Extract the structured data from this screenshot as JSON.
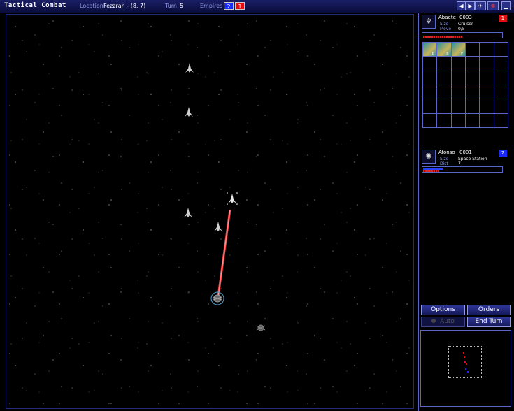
{
  "topbar": {
    "title": "Tactical Combat",
    "location_label": "Location",
    "location_value": "Fezzran - (8, 7)",
    "turn_label": "Turn",
    "turn_value": "5",
    "empires_label": "Empires",
    "empire_badges": [
      {
        "text": "2",
        "color": "#1a2aff"
      },
      {
        "text": "1",
        "color": "#e01010"
      }
    ],
    "buttons": [
      {
        "name": "arrow-left-icon",
        "glyph": "◀"
      },
      {
        "name": "arrow-right-icon",
        "glyph": "▶"
      },
      {
        "name": "bird-icon",
        "glyph": "✈"
      },
      {
        "name": "close-circle-icon",
        "glyph": "⊗"
      },
      {
        "name": "minimize-icon",
        "glyph": "▁"
      }
    ]
  },
  "colors": {
    "frame": "#5a66c8",
    "laser": "#ff4444",
    "empire_red": "#e01010",
    "empire_blue": "#1a2aff"
  },
  "map": {
    "ships": [
      {
        "name": "ship",
        "icon": "cruiser-icon"
      },
      {
        "name": "ship",
        "icon": "cruiser-icon"
      },
      {
        "name": "ship-selected",
        "icon": "cruiser-icon"
      },
      {
        "name": "ship",
        "icon": "cruiser-icon"
      },
      {
        "name": "ship",
        "icon": "cruiser-icon"
      },
      {
        "name": "space-station",
        "icon": "station-icon"
      },
      {
        "name": "space-station-2",
        "icon": "station-icon"
      }
    ]
  },
  "selected_ship": {
    "name": "Abaete",
    "number": "0003",
    "size_label": "Size",
    "size_value": "Cruiser",
    "move_label": "Move",
    "move_value": "0/5",
    "badge": "1",
    "badge_color": "#e01010",
    "hp_fraction": 0.5,
    "components": [
      {
        "label": "B"
      },
      {
        "label": "B"
      },
      {
        "label": "V"
      }
    ]
  },
  "target": {
    "name": "Afonso",
    "number": "0001",
    "size_label": "Size",
    "size_value": "Space Station",
    "dist_label": "Dist",
    "dist_value": "7",
    "badge": "2",
    "badge_color": "#1a2aff",
    "shield_fraction": 0.25,
    "hp_fraction": 0.2
  },
  "controls": {
    "options_label": "Options",
    "orders_label": "Orders",
    "auto_label": "Auto",
    "end_turn_label": "End Turn"
  }
}
